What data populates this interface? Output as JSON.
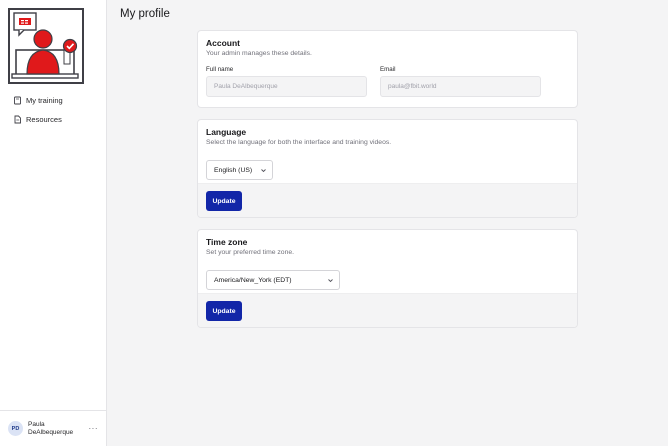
{
  "sidebar": {
    "items": [
      {
        "label": "My training",
        "icon": "book-icon"
      },
      {
        "label": "Resources",
        "icon": "document-icon"
      }
    ],
    "user": {
      "initials": "PD",
      "name": "Paula DeAlbequerque",
      "more": "···"
    }
  },
  "page": {
    "title": "My profile"
  },
  "account": {
    "title": "Account",
    "description": "Your admin manages these details.",
    "full_name_label": "Full name",
    "full_name_value": "Paula DeAlbequerque",
    "email_label": "Email",
    "email_value": "paula@fbit.world"
  },
  "language": {
    "title": "Language",
    "description": "Select the language for both the interface and training videos.",
    "selected": "English (US)",
    "button": "Update"
  },
  "timezone": {
    "title": "Time zone",
    "description": "Set your preferred time zone.",
    "selected": "America/New_York (EDT)",
    "button": "Update"
  },
  "colors": {
    "accent": "#1226a8",
    "brand_red": "#e0191b"
  }
}
